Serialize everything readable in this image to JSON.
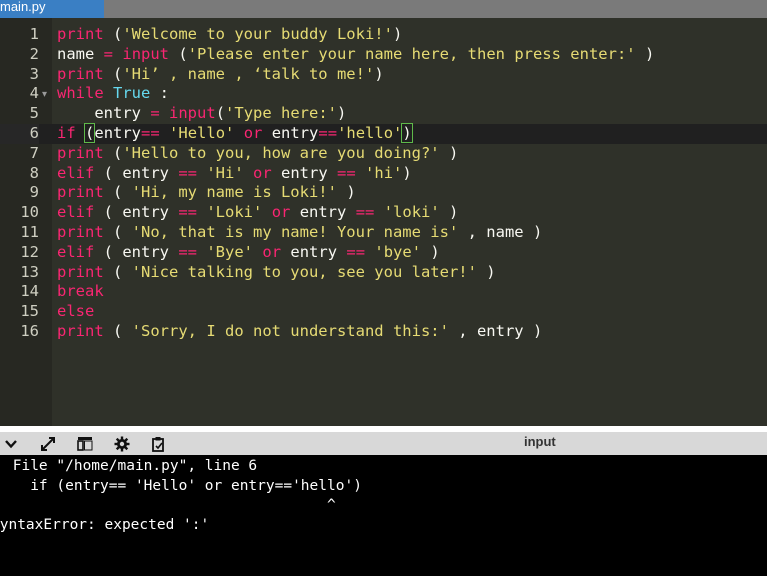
{
  "tab": {
    "label": "main.py"
  },
  "editor": {
    "lines": [
      {
        "num": "1",
        "tokens": [
          {
            "t": "print",
            "c": "kw"
          },
          {
            "t": " ("
          },
          {
            "t": "'Welcome to your buddy Loki!'",
            "c": "st"
          },
          {
            "t": ")"
          }
        ]
      },
      {
        "num": "2",
        "tokens": [
          {
            "t": "name "
          },
          {
            "t": "=",
            "c": "op"
          },
          {
            "t": " "
          },
          {
            "t": "input",
            "c": "fn"
          },
          {
            "t": " ("
          },
          {
            "t": "'Please enter your name here, then press enter:'",
            "c": "st"
          },
          {
            "t": " )"
          }
        ]
      },
      {
        "num": "3",
        "tokens": [
          {
            "t": "print",
            "c": "kw"
          },
          {
            "t": " ("
          },
          {
            "t": "'Hi’ , name , ‘talk to me!'",
            "c": "st"
          },
          {
            "t": ")"
          }
        ]
      },
      {
        "num": "4",
        "fold": true,
        "tokens": [
          {
            "t": "while",
            "c": "kw"
          },
          {
            "t": " "
          },
          {
            "t": "True",
            "c": "bi"
          },
          {
            "t": " :"
          }
        ]
      },
      {
        "num": "5",
        "tokens": [
          {
            "t": "    entry "
          },
          {
            "t": "=",
            "c": "op"
          },
          {
            "t": " "
          },
          {
            "t": "input",
            "c": "fn"
          },
          {
            "t": "("
          },
          {
            "t": "'Type here:'",
            "c": "st"
          },
          {
            "t": ")"
          }
        ]
      },
      {
        "num": "6",
        "active": true,
        "tokens": [
          {
            "t": "if",
            "c": "kw"
          },
          {
            "t": " "
          },
          {
            "t": "(",
            "c": "bkt"
          },
          {
            "t": "entry"
          },
          {
            "t": "==",
            "c": "op"
          },
          {
            "t": " "
          },
          {
            "t": "'Hello'",
            "c": "st"
          },
          {
            "t": " "
          },
          {
            "t": "or",
            "c": "kw"
          },
          {
            "t": " entry"
          },
          {
            "t": "==",
            "c": "op"
          },
          {
            "t": "'hello'",
            "c": "st"
          },
          {
            "t": ")",
            "c": "bkt"
          }
        ]
      },
      {
        "num": "7",
        "tokens": [
          {
            "t": "print",
            "c": "kw"
          },
          {
            "t": " ("
          },
          {
            "t": "'Hello to you, how are you doing?'",
            "c": "st"
          },
          {
            "t": " )"
          }
        ]
      },
      {
        "num": "8",
        "tokens": [
          {
            "t": "elif",
            "c": "kw"
          },
          {
            "t": " ( entry "
          },
          {
            "t": "==",
            "c": "op"
          },
          {
            "t": " "
          },
          {
            "t": "'Hi'",
            "c": "st"
          },
          {
            "t": " "
          },
          {
            "t": "or",
            "c": "kw"
          },
          {
            "t": " entry "
          },
          {
            "t": "==",
            "c": "op"
          },
          {
            "t": " "
          },
          {
            "t": "'hi'",
            "c": "st"
          },
          {
            "t": ")"
          }
        ]
      },
      {
        "num": "9",
        "tokens": [
          {
            "t": "print",
            "c": "kw"
          },
          {
            "t": " ( "
          },
          {
            "t": "'Hi, my name is Loki!'",
            "c": "st"
          },
          {
            "t": " )"
          }
        ]
      },
      {
        "num": "10",
        "tokens": [
          {
            "t": "elif",
            "c": "kw"
          },
          {
            "t": " ( entry "
          },
          {
            "t": "==",
            "c": "op"
          },
          {
            "t": " "
          },
          {
            "t": "'Loki'",
            "c": "st"
          },
          {
            "t": " "
          },
          {
            "t": "or",
            "c": "kw"
          },
          {
            "t": " entry "
          },
          {
            "t": "==",
            "c": "op"
          },
          {
            "t": " "
          },
          {
            "t": "'loki'",
            "c": "st"
          },
          {
            "t": " )"
          }
        ]
      },
      {
        "num": "11",
        "tokens": [
          {
            "t": "print",
            "c": "kw"
          },
          {
            "t": " ( "
          },
          {
            "t": "'No, that is my name! Your name is'",
            "c": "st"
          },
          {
            "t": " , name )"
          }
        ]
      },
      {
        "num": "12",
        "tokens": [
          {
            "t": "elif",
            "c": "kw"
          },
          {
            "t": " ( entry "
          },
          {
            "t": "==",
            "c": "op"
          },
          {
            "t": " "
          },
          {
            "t": "'Bye'",
            "c": "st"
          },
          {
            "t": " "
          },
          {
            "t": "or",
            "c": "kw"
          },
          {
            "t": " entry "
          },
          {
            "t": "==",
            "c": "op"
          },
          {
            "t": " "
          },
          {
            "t": "'bye'",
            "c": "st"
          },
          {
            "t": " )"
          }
        ]
      },
      {
        "num": "13",
        "tokens": [
          {
            "t": "print",
            "c": "kw"
          },
          {
            "t": " ( "
          },
          {
            "t": "'Nice talking to you, see you later!'",
            "c": "st"
          },
          {
            "t": " )"
          }
        ]
      },
      {
        "num": "14",
        "tokens": [
          {
            "t": "break",
            "c": "kw"
          }
        ]
      },
      {
        "num": "15",
        "tokens": [
          {
            "t": "else",
            "c": "kw"
          }
        ]
      },
      {
        "num": "16",
        "tokens": [
          {
            "t": "print",
            "c": "kw"
          },
          {
            "t": " ( "
          },
          {
            "t": "'Sorry, I do not understand this:'",
            "c": "st"
          },
          {
            "t": " , entry )"
          }
        ]
      }
    ]
  },
  "toolbar": {
    "icons": [
      "chevron-down-icon",
      "expand-icon",
      "layout-icon",
      "gear-icon",
      "clipboard-icon"
    ],
    "input_label": "input"
  },
  "console": {
    "lines": [
      " File \"/home/main.py\", line 6",
      "   if (entry== 'Hello' or entry=='hello')",
      "                                     ^",
      "SyntaxError: expected ':'"
    ]
  },
  "colors": {
    "editor_bg": "#2f3129",
    "gutter_bg": "#272822",
    "keyword": "#f92672",
    "string": "#e6db74",
    "builtin": "#66d9ef",
    "tab_active": "#3a7fc4",
    "console_bg": "#000000"
  }
}
